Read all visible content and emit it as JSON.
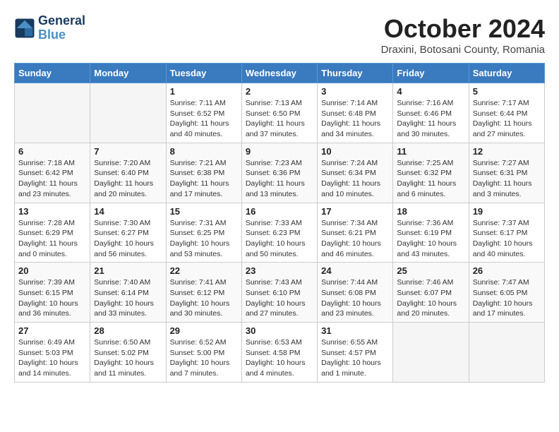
{
  "logo": {
    "line1": "General",
    "line2": "Blue"
  },
  "title": "October 2024",
  "location": "Draxini, Botosani County, Romania",
  "days_of_week": [
    "Sunday",
    "Monday",
    "Tuesday",
    "Wednesday",
    "Thursday",
    "Friday",
    "Saturday"
  ],
  "weeks": [
    [
      {
        "day": "",
        "detail": ""
      },
      {
        "day": "",
        "detail": ""
      },
      {
        "day": "1",
        "detail": "Sunrise: 7:11 AM\nSunset: 6:52 PM\nDaylight: 11 hours and 40 minutes."
      },
      {
        "day": "2",
        "detail": "Sunrise: 7:13 AM\nSunset: 6:50 PM\nDaylight: 11 hours and 37 minutes."
      },
      {
        "day": "3",
        "detail": "Sunrise: 7:14 AM\nSunset: 6:48 PM\nDaylight: 11 hours and 34 minutes."
      },
      {
        "day": "4",
        "detail": "Sunrise: 7:16 AM\nSunset: 6:46 PM\nDaylight: 11 hours and 30 minutes."
      },
      {
        "day": "5",
        "detail": "Sunrise: 7:17 AM\nSunset: 6:44 PM\nDaylight: 11 hours and 27 minutes."
      }
    ],
    [
      {
        "day": "6",
        "detail": "Sunrise: 7:18 AM\nSunset: 6:42 PM\nDaylight: 11 hours and 23 minutes."
      },
      {
        "day": "7",
        "detail": "Sunrise: 7:20 AM\nSunset: 6:40 PM\nDaylight: 11 hours and 20 minutes."
      },
      {
        "day": "8",
        "detail": "Sunrise: 7:21 AM\nSunset: 6:38 PM\nDaylight: 11 hours and 17 minutes."
      },
      {
        "day": "9",
        "detail": "Sunrise: 7:23 AM\nSunset: 6:36 PM\nDaylight: 11 hours and 13 minutes."
      },
      {
        "day": "10",
        "detail": "Sunrise: 7:24 AM\nSunset: 6:34 PM\nDaylight: 11 hours and 10 minutes."
      },
      {
        "day": "11",
        "detail": "Sunrise: 7:25 AM\nSunset: 6:32 PM\nDaylight: 11 hours and 6 minutes."
      },
      {
        "day": "12",
        "detail": "Sunrise: 7:27 AM\nSunset: 6:31 PM\nDaylight: 11 hours and 3 minutes."
      }
    ],
    [
      {
        "day": "13",
        "detail": "Sunrise: 7:28 AM\nSunset: 6:29 PM\nDaylight: 11 hours and 0 minutes."
      },
      {
        "day": "14",
        "detail": "Sunrise: 7:30 AM\nSunset: 6:27 PM\nDaylight: 10 hours and 56 minutes."
      },
      {
        "day": "15",
        "detail": "Sunrise: 7:31 AM\nSunset: 6:25 PM\nDaylight: 10 hours and 53 minutes."
      },
      {
        "day": "16",
        "detail": "Sunrise: 7:33 AM\nSunset: 6:23 PM\nDaylight: 10 hours and 50 minutes."
      },
      {
        "day": "17",
        "detail": "Sunrise: 7:34 AM\nSunset: 6:21 PM\nDaylight: 10 hours and 46 minutes."
      },
      {
        "day": "18",
        "detail": "Sunrise: 7:36 AM\nSunset: 6:19 PM\nDaylight: 10 hours and 43 minutes."
      },
      {
        "day": "19",
        "detail": "Sunrise: 7:37 AM\nSunset: 6:17 PM\nDaylight: 10 hours and 40 minutes."
      }
    ],
    [
      {
        "day": "20",
        "detail": "Sunrise: 7:39 AM\nSunset: 6:15 PM\nDaylight: 10 hours and 36 minutes."
      },
      {
        "day": "21",
        "detail": "Sunrise: 7:40 AM\nSunset: 6:14 PM\nDaylight: 10 hours and 33 minutes."
      },
      {
        "day": "22",
        "detail": "Sunrise: 7:41 AM\nSunset: 6:12 PM\nDaylight: 10 hours and 30 minutes."
      },
      {
        "day": "23",
        "detail": "Sunrise: 7:43 AM\nSunset: 6:10 PM\nDaylight: 10 hours and 27 minutes."
      },
      {
        "day": "24",
        "detail": "Sunrise: 7:44 AM\nSunset: 6:08 PM\nDaylight: 10 hours and 23 minutes."
      },
      {
        "day": "25",
        "detail": "Sunrise: 7:46 AM\nSunset: 6:07 PM\nDaylight: 10 hours and 20 minutes."
      },
      {
        "day": "26",
        "detail": "Sunrise: 7:47 AM\nSunset: 6:05 PM\nDaylight: 10 hours and 17 minutes."
      }
    ],
    [
      {
        "day": "27",
        "detail": "Sunrise: 6:49 AM\nSunset: 5:03 PM\nDaylight: 10 hours and 14 minutes."
      },
      {
        "day": "28",
        "detail": "Sunrise: 6:50 AM\nSunset: 5:02 PM\nDaylight: 10 hours and 11 minutes."
      },
      {
        "day": "29",
        "detail": "Sunrise: 6:52 AM\nSunset: 5:00 PM\nDaylight: 10 hours and 7 minutes."
      },
      {
        "day": "30",
        "detail": "Sunrise: 6:53 AM\nSunset: 4:58 PM\nDaylight: 10 hours and 4 minutes."
      },
      {
        "day": "31",
        "detail": "Sunrise: 6:55 AM\nSunset: 4:57 PM\nDaylight: 10 hours and 1 minute."
      },
      {
        "day": "",
        "detail": ""
      },
      {
        "day": "",
        "detail": ""
      }
    ]
  ]
}
